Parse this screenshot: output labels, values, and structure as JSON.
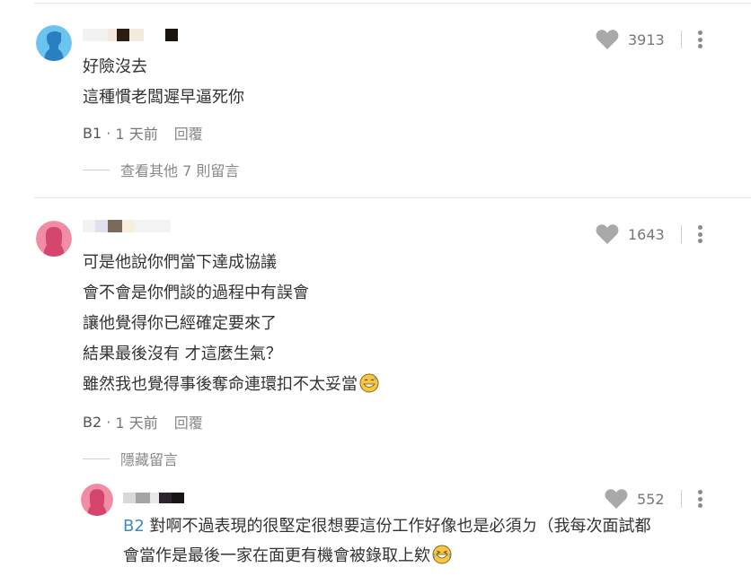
{
  "comments": [
    {
      "likes": "3913",
      "lines": [
        "好險沒去",
        "這種慣老闆遲早逼死你"
      ],
      "floor": "B1",
      "time": "1 天前",
      "reply_label": "回覆",
      "thread_toggle": "查看其他 7 則留言",
      "avatar_color": "#6bc3ee",
      "name_blocks": [
        "#f2f2f2",
        "#f5eadd",
        "#2b1d14",
        "#f3ebdd",
        "#ffffff",
        "#1b1410"
      ]
    },
    {
      "likes": "1643",
      "lines": [
        "可是他說你們當下達成協議",
        "會不會是你們談的過程中有誤會",
        "讓他覺得你已經確定要來了",
        "結果最後沒有 才這麼生氣？",
        "雖然我也覺得事後奪命連環扣不太妥當"
      ],
      "floor": "B2",
      "time": "1 天前",
      "reply_label": "回覆",
      "thread_toggle": "隱藏留言",
      "avatar_color": "#f08ca4",
      "name_blocks": [
        "#f2f2f2",
        "#e0e0ef",
        "#7a6a5a",
        "#f6efde",
        "#f3f3f3"
      ]
    }
  ],
  "reply": {
    "likes": "552",
    "floor_tag": "B2",
    "line1": " 對啊不過表現的很堅定很想要這份工作好像也是必須ㄉ（我每次面試都",
    "line2": "會當作是最後一家在面更有機會被錄取上欸",
    "avatar_color": "#f08ca4",
    "name_blocks": [
      "#d9d9d9",
      "#a5a5a5",
      "#e8e8e8",
      "#2c2230",
      "#1a1418",
      "#ffffff"
    ]
  },
  "icons": {
    "heart": "heart-icon",
    "more": "more-vertical-icon",
    "emoji": "grinning-sweat-emoji-icon"
  }
}
